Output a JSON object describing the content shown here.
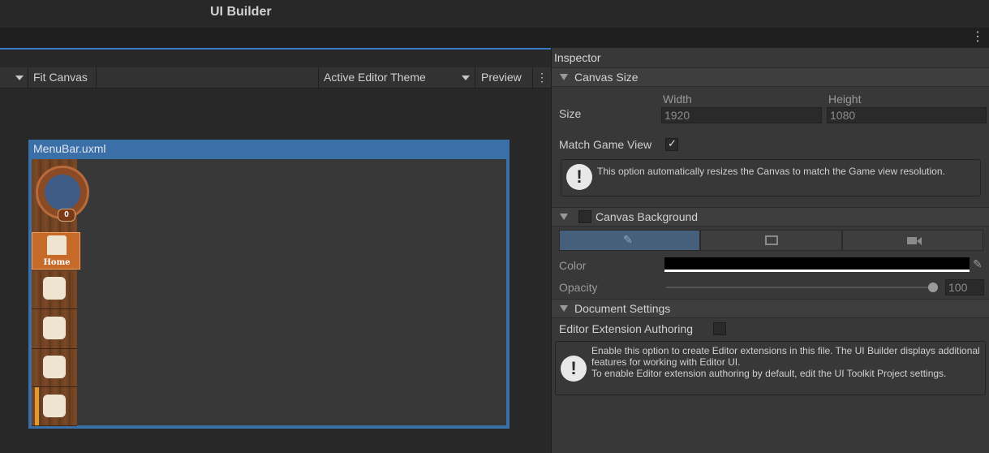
{
  "app": {
    "title": "UI Builder"
  },
  "viewport": {
    "toolbar": {
      "zoom_label": "Fit Canvas",
      "theme_label": "Active Editor Theme",
      "preview_label": "Preview"
    },
    "canvas": {
      "file_name": "MenuBar.uxml",
      "menubar": {
        "badge_count": "0",
        "home_label": "Home"
      }
    }
  },
  "inspector": {
    "title": "Inspector",
    "canvas_size": {
      "header": "Canvas Size",
      "size_label": "Size",
      "width_label": "Width",
      "width_value": "1920",
      "height_label": "Height",
      "height_value": "1080",
      "match_label": "Match Game View",
      "match_checked": true,
      "help": "This option automatically resizes the Canvas to match the Game view resolution."
    },
    "canvas_background": {
      "header": "Canvas Background",
      "color_label": "Color",
      "color_value": "#000000",
      "opacity_label": "Opacity",
      "opacity_value": "100"
    },
    "document_settings": {
      "header": "Document Settings",
      "authoring_label": "Editor Extension Authoring",
      "help_line1": "Enable this option to create Editor extensions in this file. The UI Builder displays additional features for working with Editor UI.",
      "help_line2": "To enable Editor extension authoring by default, edit the UI Toolkit Project settings."
    }
  }
}
